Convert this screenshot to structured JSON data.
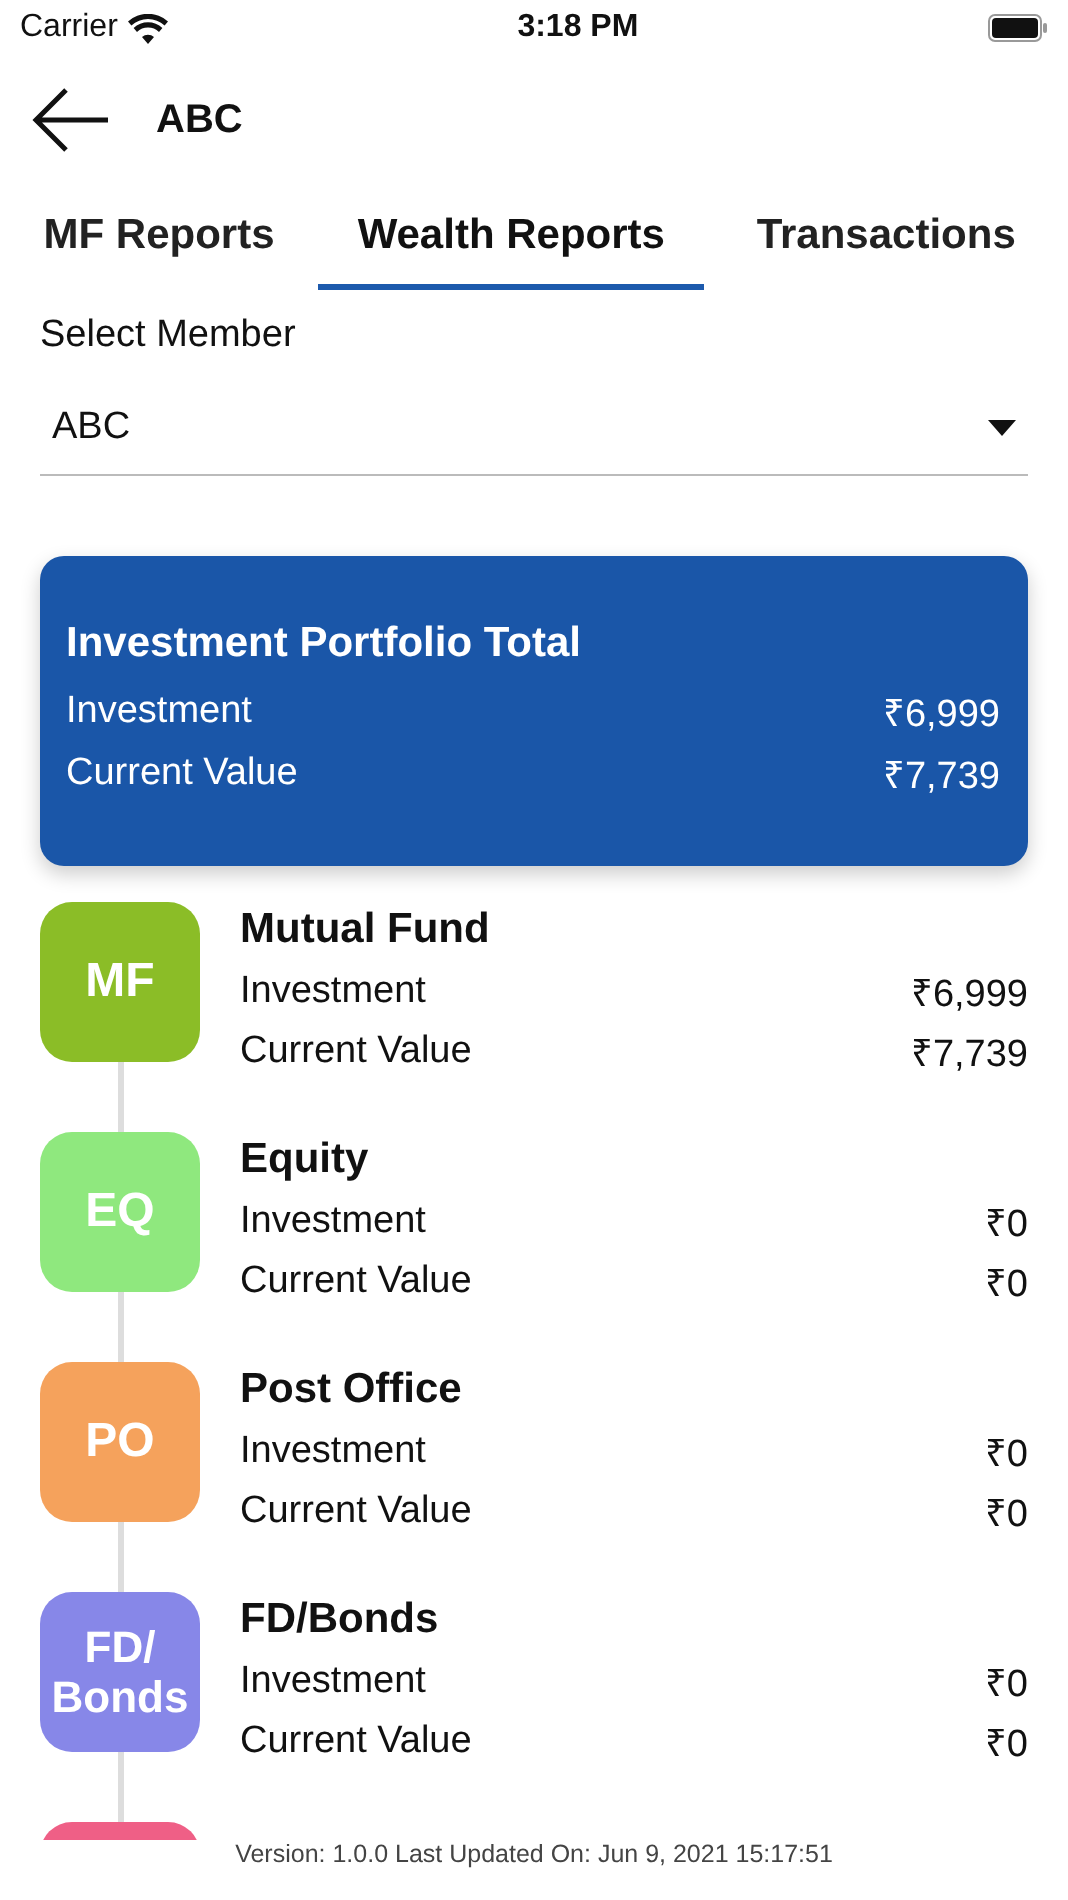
{
  "status_bar": {
    "carrier": "Carrier",
    "time": "3:18 PM"
  },
  "header": {
    "title": "ABC"
  },
  "tabs": [
    {
      "label": "MF Reports",
      "selected": false
    },
    {
      "label": "Wealth Reports",
      "selected": true
    },
    {
      "label": "Transactions",
      "selected": false
    }
  ],
  "member_select": {
    "label": "Select Member",
    "value": "ABC"
  },
  "summary": {
    "title": "Investment Portfolio Total",
    "rows": [
      {
        "label": "Investment",
        "value": "₹6,999"
      },
      {
        "label": "Current Value",
        "value": "₹7,739"
      }
    ]
  },
  "assets": [
    {
      "kind": "full",
      "badge": "MF",
      "color": "#8bbd27",
      "title": "Mutual Fund",
      "rows": [
        {
          "label": "Investment",
          "value": "₹6,999"
        },
        {
          "label": "Current Value",
          "value": "₹7,739"
        }
      ]
    },
    {
      "kind": "full",
      "badge": "EQ",
      "color": "#8fe87e",
      "title": "Equity",
      "rows": [
        {
          "label": "Investment",
          "value": "₹0"
        },
        {
          "label": "Current Value",
          "value": "₹0"
        }
      ]
    },
    {
      "kind": "full",
      "badge": "PO",
      "color": "#f5a25c",
      "title": "Post Office",
      "rows": [
        {
          "label": "Investment",
          "value": "₹0"
        },
        {
          "label": "Current Value",
          "value": "₹0"
        }
      ]
    },
    {
      "kind": "full",
      "badge": "FD/ Bonds",
      "color": "#8787e8",
      "title": "FD/Bonds",
      "rows": [
        {
          "label": "Investment",
          "value": "₹0"
        },
        {
          "label": "Current Value",
          "value": "₹0"
        }
      ]
    },
    {
      "kind": "partial",
      "color": "#ef5f86"
    }
  ],
  "footer": "Version: 1.0.0 Last Updated On: Jun 9, 2021 15:17:51"
}
